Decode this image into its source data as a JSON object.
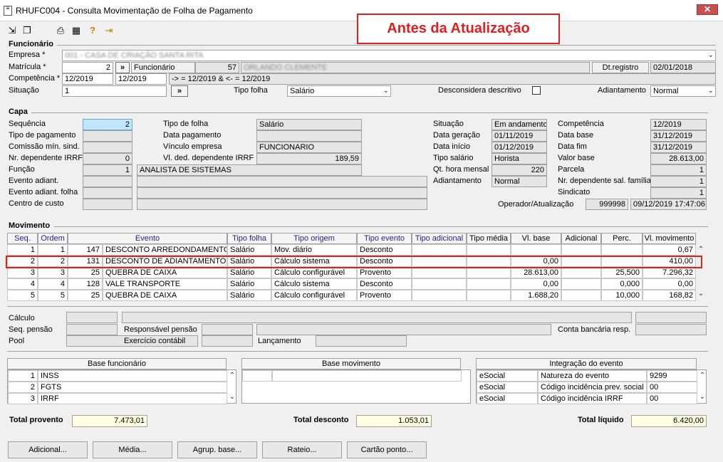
{
  "window": {
    "title": "RHUFC004 - Consulta Movimentação de Folha de Pagamento",
    "close_label": "✕"
  },
  "annotation": {
    "text": "Antes da Atualização"
  },
  "funcionario": {
    "section_title": "Funcionário",
    "empresa_label": "Empresa *",
    "empresa_value": "001 - CASA DE CRIAÇÃO SANTA RITA",
    "matricula_label": "Matrícula *",
    "matricula_value": "2",
    "matricula_btn": "»",
    "funcionario_label": "Funcionário",
    "funcionario_num": "57",
    "funcionario_name": "ORLANDO CLEMENTE",
    "dtregistro_label": "Dt.registro",
    "dtregistro_value": "02/01/2018",
    "competencia_label": "Competência *",
    "competencia_from": "12/2019",
    "competencia_to": "12/2019",
    "competencia_range": "-> = 12/2019  & <- = 12/2019",
    "situacao_label": "Situação",
    "situacao_value": "1",
    "situacao_btn": "»",
    "tipofolha_label": "Tipo folha",
    "tipofolha_value": "Salário",
    "desconsidera_label": "Desconsidera descritivo",
    "adiantamento_label": "Adiantamento",
    "adiantamento_value": "Normal"
  },
  "capa": {
    "section_title": "Capa",
    "sequencia_label": "Sequência",
    "sequencia_value": "2",
    "tipo_pagamento_label": "Tipo de pagamento",
    "comissao_label": "Comissão mín. sind.",
    "nr_dep_irrf_label": "Nr. dependente IRRF",
    "nr_dep_irrf_value": "0",
    "funcao_label": "Função",
    "funcao_num": "1",
    "funcao_name": "ANALISTA DE SISTEMAS",
    "evento_adiant_label": "Evento adiant.",
    "evento_adiant_folha_label": "Evento adiant. folha",
    "centro_custo_label": "Centro de custo",
    "tipo_folha_label": "Tipo de folha",
    "tipo_folha_value": "Salário",
    "data_pagamento_label": "Data pagamento",
    "vinculo_label": "Vínculo empresa",
    "vinculo_value": "FUNCIONARIO",
    "vl_ded_label": "Vl. ded. dependente IRRF",
    "vl_ded_value": "189,59",
    "situacao_label": "Situação",
    "situacao_value": "Em andamento",
    "data_geracao_label": "Data geração",
    "data_geracao_value": "01/11/2019",
    "data_inicio_label": "Data início",
    "data_inicio_value": "01/12/2019",
    "tipo_salario_label": "Tipo salário",
    "tipo_salario_value": "Horista",
    "qt_hora_label": "Qt. hora mensal",
    "qt_hora_value": "220",
    "adiantamento_label": "Adiantamento",
    "adiantamento_value": "Normal",
    "competencia_label": "Competência",
    "competencia_value": "12/2019",
    "data_base_label": "Data base",
    "data_base_value": "31/12/2019",
    "data_fim_label": "Data fim",
    "data_fim_value": "31/12/2019",
    "valor_base_label": "Valor base",
    "valor_base_value": "28.613,00",
    "parcela_label": "Parcela",
    "parcela_value": "1",
    "nr_dep_sal_label": "Nr. dependente sal. família",
    "nr_dep_sal_value": "1",
    "sindicato_label": "Sindicato",
    "sindicato_value": "1",
    "operador_label": "Operador/Atualização",
    "operador_value": "999998",
    "operador_datetime": "09/12/2019 17:47:06"
  },
  "movimento": {
    "section_title": "Movimento",
    "columns": [
      "Seq.",
      "Ordem",
      "Evento",
      "Tipo folha",
      "Tipo origem",
      "Tipo evento",
      "Tipo adicional",
      "Tipo média",
      "Vl. base",
      "Adicional",
      "Perc.",
      "Vl. movimento"
    ],
    "rows": [
      {
        "seq": "1",
        "ordem": "1",
        "evento_cod": "147",
        "evento": "DESCONTO ARREDONDAMENTO SALÁRIO",
        "tipo_folha": "Salário",
        "tipo_origem": "Mov. diário",
        "tipo_evento": "Desconto",
        "tipo_adicional": "",
        "tipo_media": "",
        "vl_base": "",
        "adicional": "",
        "perc": "",
        "vl_movimento": "0,67"
      },
      {
        "seq": "2",
        "ordem": "2",
        "evento_cod": "131",
        "evento": "DESCONTO DE ADIANTAMENTO DE SALÁRIO",
        "tipo_folha": "Salário",
        "tipo_origem": "Cálculo sistema",
        "tipo_evento": "Desconto",
        "tipo_adicional": "",
        "tipo_media": "",
        "vl_base": "0,00",
        "adicional": "",
        "perc": "",
        "vl_movimento": "410,00"
      },
      {
        "seq": "3",
        "ordem": "3",
        "evento_cod": "25",
        "evento": "QUEBRA DE CAIXA",
        "tipo_folha": "Salário",
        "tipo_origem": "Cálculo configurável",
        "tipo_evento": "Provento",
        "tipo_adicional": "",
        "tipo_media": "",
        "vl_base": "28.613,00",
        "adicional": "",
        "perc": "25,500",
        "vl_movimento": "7.296,32"
      },
      {
        "seq": "4",
        "ordem": "4",
        "evento_cod": "128",
        "evento": "VALE TRANSPORTE",
        "tipo_folha": "Salário",
        "tipo_origem": "Cálculo sistema",
        "tipo_evento": "Desconto",
        "tipo_adicional": "",
        "tipo_media": "",
        "vl_base": "0,00",
        "adicional": "",
        "perc": "0,000",
        "vl_movimento": "0,00"
      },
      {
        "seq": "5",
        "ordem": "5",
        "evento_cod": "25",
        "evento": "QUEBRA DE CAIXA",
        "tipo_folha": "Salário",
        "tipo_origem": "Cálculo configurável",
        "tipo_evento": "Provento",
        "tipo_adicional": "",
        "tipo_media": "",
        "vl_base": "1.688,20",
        "adicional": "",
        "perc": "10,000",
        "vl_movimento": "168,82"
      }
    ]
  },
  "detalhe": {
    "calculo_label": "Cálculo",
    "seq_pensao_label": "Seq. pensão",
    "responsavel_label": "Responsável pensão",
    "conta_label": "Conta bancária resp.",
    "pool_label": "Pool",
    "exercicio_label": "Exercício contábil",
    "lancamento_label": "Lançamento"
  },
  "base_funcionario": {
    "title": "Base funcionário",
    "rows": [
      {
        "num": "1",
        "name": "INSS"
      },
      {
        "num": "2",
        "name": "FGTS"
      },
      {
        "num": "3",
        "name": "IRRF"
      }
    ]
  },
  "base_movimento": {
    "title": "Base movimento"
  },
  "integracao": {
    "title": "Integração do evento",
    "rows": [
      {
        "origem": "eSocial",
        "campo": "Natureza do evento",
        "valor": "9299"
      },
      {
        "origem": "eSocial",
        "campo": "Código incidência prev. social",
        "valor": "00"
      },
      {
        "origem": "eSocial",
        "campo": "Código incidência IRRF",
        "valor": "00"
      }
    ]
  },
  "totais": {
    "provento_label": "Total provento",
    "provento_value": "7.473,01",
    "desconto_label": "Total desconto",
    "desconto_value": "1.053,01",
    "liquido_label": "Total líquido",
    "liquido_value": "6.420,00"
  },
  "buttons": {
    "adicional": "Adicional...",
    "media": "Média...",
    "agrup": "Agrup. base...",
    "rateio": "Rateio...",
    "cartao": "Cartão ponto..."
  },
  "scroll": {
    "up": "⌃",
    "down": "⌄"
  },
  "combo": {
    "arrow": "⌄"
  }
}
